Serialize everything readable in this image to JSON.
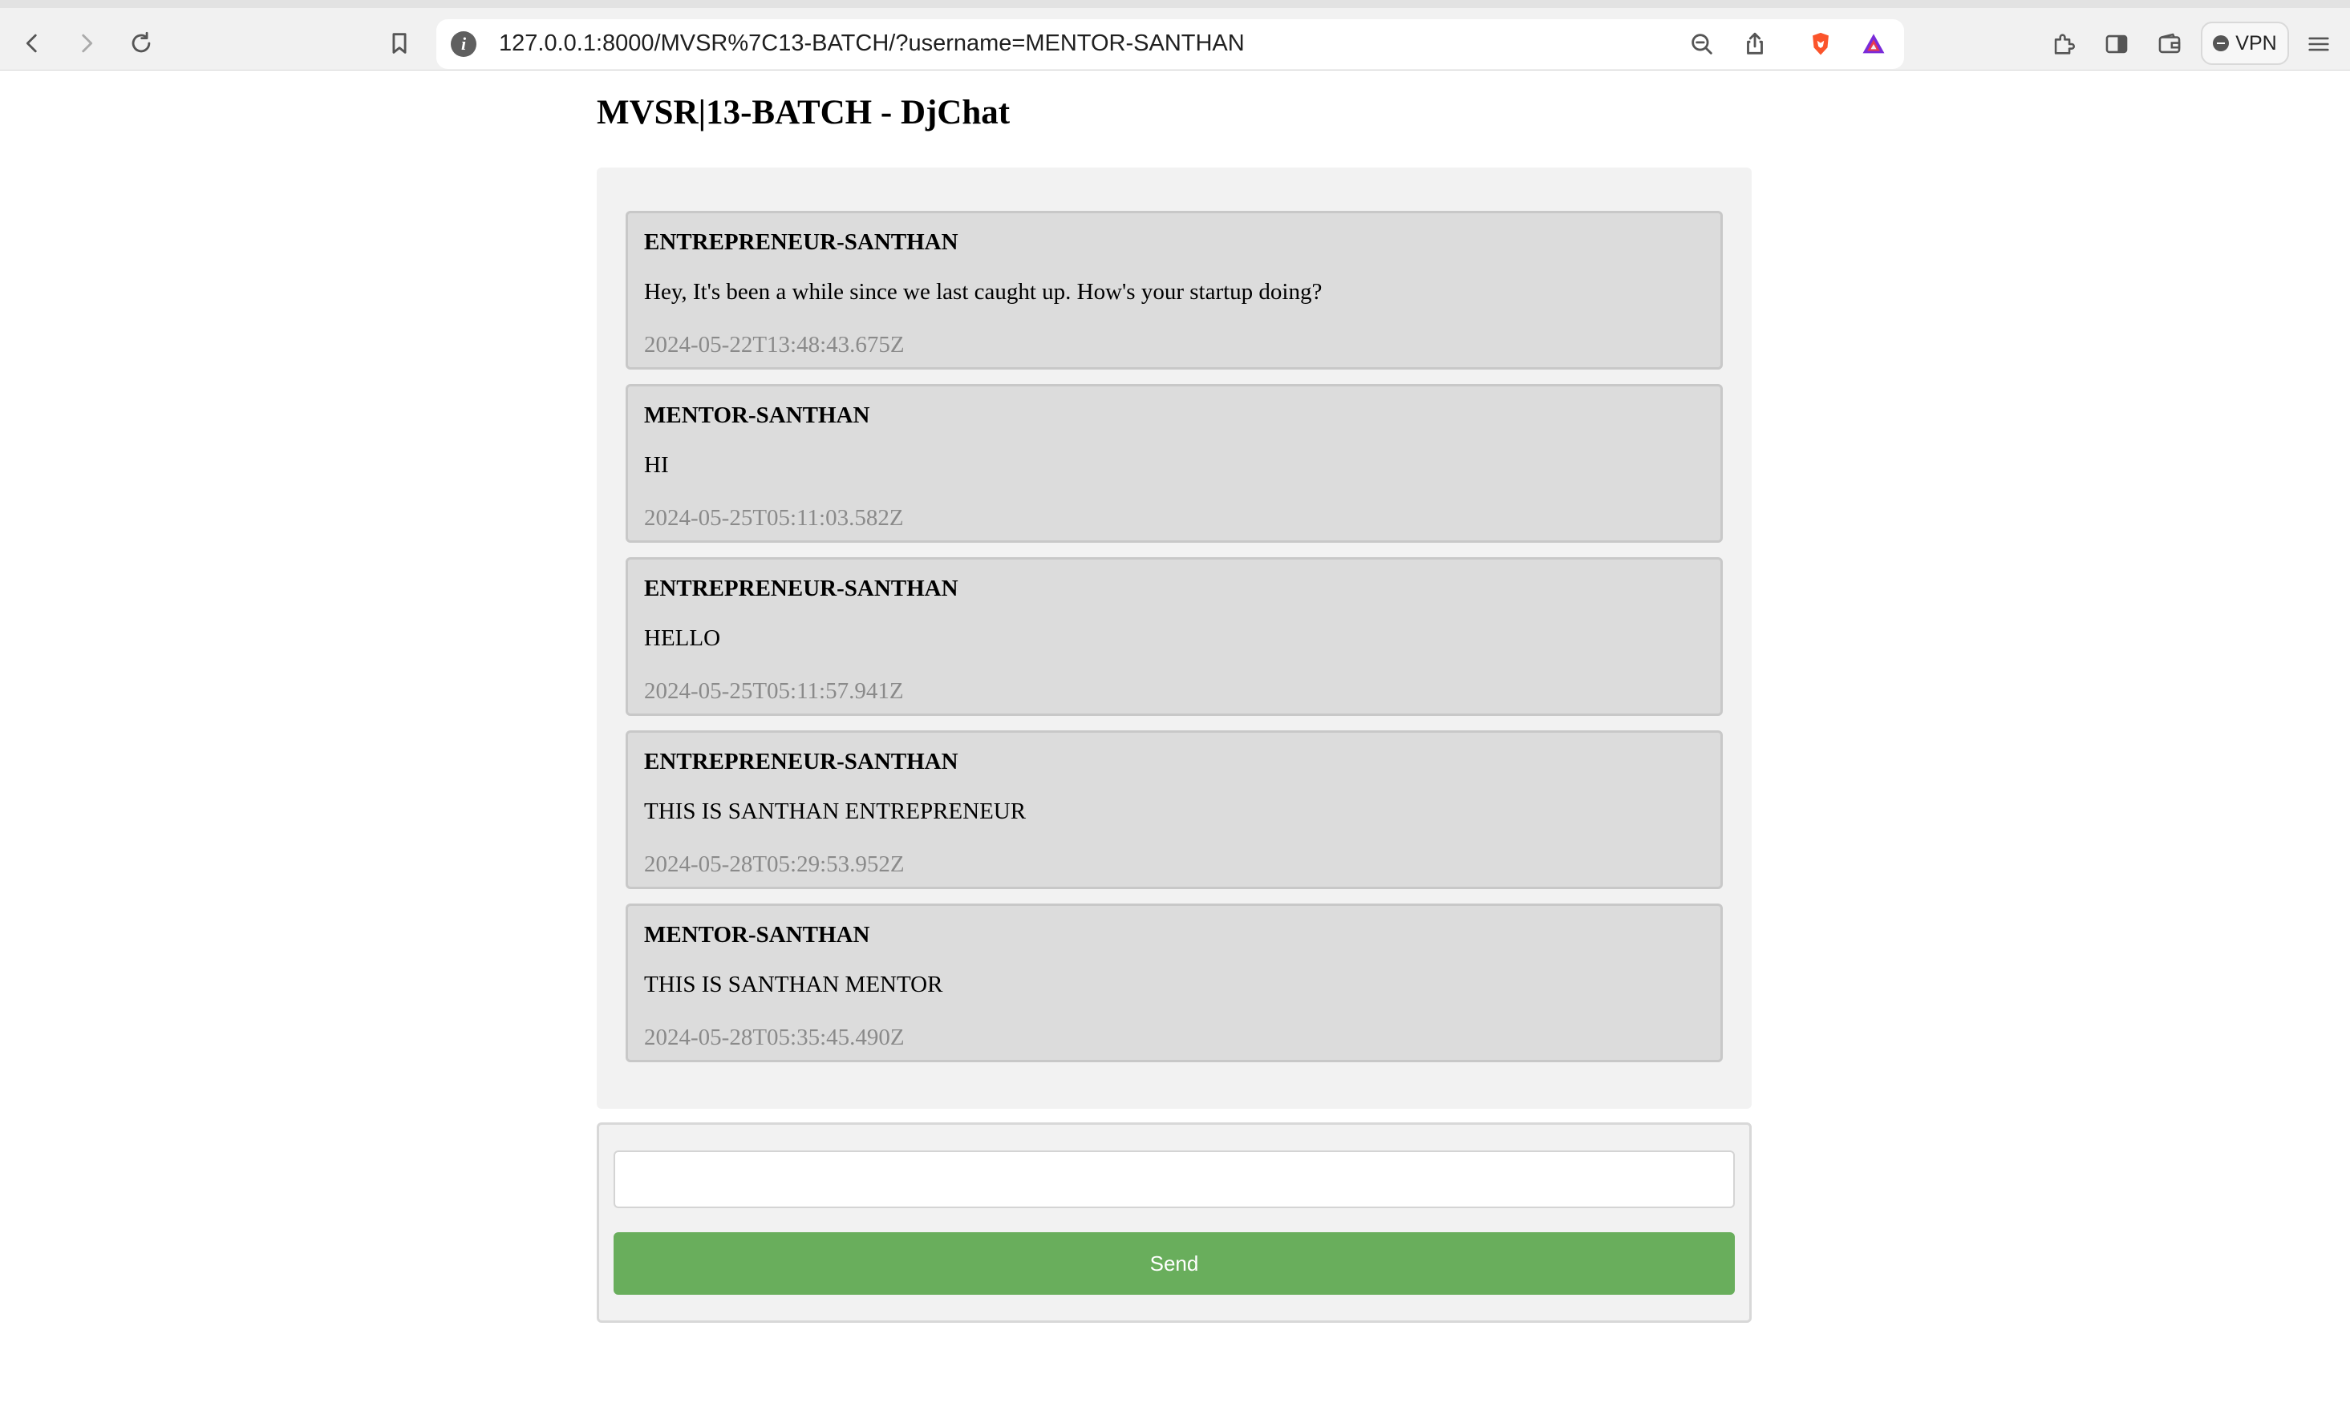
{
  "browser": {
    "url": "127.0.0.1:8000/MVSR%7C13-BATCH/?username=MENTOR-SANTHAN",
    "vpn_label": "VPN",
    "colors": {
      "brave_orange": "#fb542b",
      "rewards_purple": "#7a2bd9",
      "rewards_red": "#e8384f"
    },
    "icons": [
      "back-arrow-icon",
      "forward-arrow-icon",
      "reload-icon",
      "bookmark-icon",
      "site-info-icon",
      "zoom-out-icon",
      "share-icon",
      "brave-shields-icon",
      "brave-rewards-icon",
      "extensions-icon",
      "sidebar-icon",
      "wallet-icon",
      "menu-icon"
    ]
  },
  "page": {
    "title": "MVSR|13-BATCH - DjChat"
  },
  "messages": [
    {
      "user": "ENTREPRENEUR-SANTHAN",
      "text": "Hey, It's been a while since we last caught up. How's your startup doing?",
      "time": "2024-05-22T13:48:43.675Z"
    },
    {
      "user": "MENTOR-SANTHAN",
      "text": "HI",
      "time": "2024-05-25T05:11:03.582Z"
    },
    {
      "user": "ENTREPRENEUR-SANTHAN",
      "text": "HELLO",
      "time": "2024-05-25T05:11:57.941Z"
    },
    {
      "user": "ENTREPRENEUR-SANTHAN",
      "text": "THIS IS SANTHAN ENTREPRENEUR",
      "time": "2024-05-28T05:29:53.952Z"
    },
    {
      "user": "MENTOR-SANTHAN",
      "text": "THIS IS SANTHAN MENTOR",
      "time": "2024-05-28T05:35:45.490Z"
    }
  ],
  "form": {
    "input_value": "",
    "input_placeholder": "",
    "send_label": "Send",
    "send_color": "#69ae5c"
  }
}
